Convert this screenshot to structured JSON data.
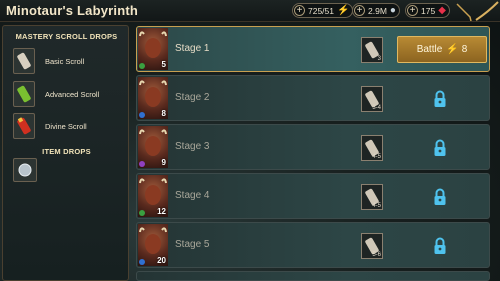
{
  "header": {
    "title": "Minotaur's Labyrinth"
  },
  "resources": [
    {
      "value": "725/51",
      "icon": "energy-bolt-icon"
    },
    {
      "value": "2.9M",
      "icon": "silver-icon"
    },
    {
      "value": "175",
      "icon": "gem-icon"
    }
  ],
  "left": {
    "mastery_title": "MASTERY SCROLL DROPS",
    "scrolls": [
      {
        "label": "Basic Scroll"
      },
      {
        "label": "Advanced Scroll"
      },
      {
        "label": "Divine Scroll"
      }
    ],
    "item_title": "ITEM DROPS"
  },
  "stages": [
    {
      "name": "Stage 1",
      "level": "5",
      "reward_qty": "3",
      "state": "active",
      "battle_label": "Battle",
      "battle_cost": "8"
    },
    {
      "name": "Stage 2",
      "level": "8",
      "reward_qty": "3-4",
      "state": "locked"
    },
    {
      "name": "Stage 3",
      "level": "9",
      "reward_qty": "4-5",
      "state": "locked"
    },
    {
      "name": "Stage 4",
      "level": "12",
      "reward_qty": "4-5",
      "state": "locked"
    },
    {
      "name": "Stage 5",
      "level": "20",
      "reward_qty": "5-6",
      "state": "locked"
    }
  ],
  "colors": {
    "accent_gold": "#c8a050",
    "lock_blue": "#4fc3ee",
    "energy_green": "#d8ff30"
  }
}
